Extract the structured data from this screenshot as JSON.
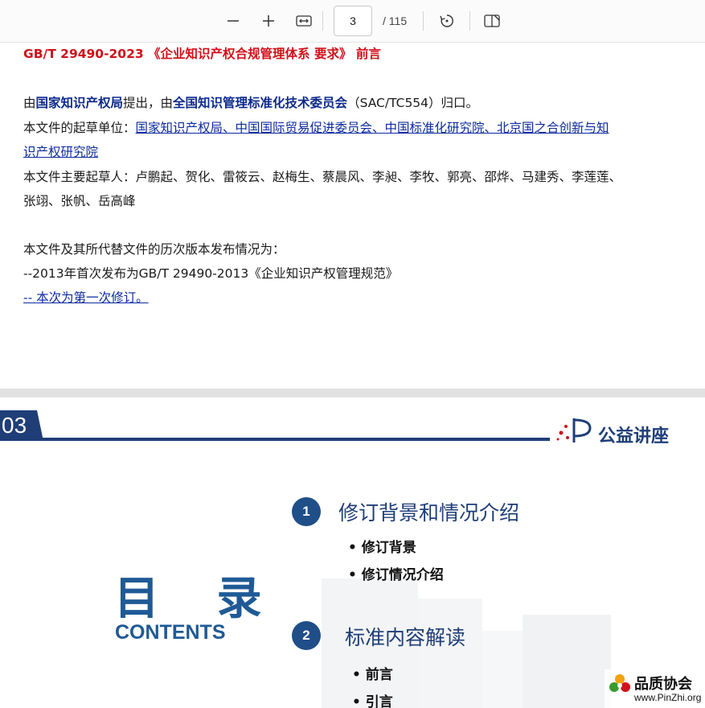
{
  "toolbar": {
    "zoom_out_icon": "minus-icon",
    "zoom_in_icon": "plus-icon",
    "fit_width_icon": "fit-width-icon",
    "page_current": "3",
    "page_total": "/ 115",
    "rotate_icon": "rotate-icon",
    "two_page_icon": "two-page-view-icon"
  },
  "page1": {
    "title": "GB/T 29490-2023 《企业知识产权合规管理体系 要求》 前言",
    "line1": {
      "prefix": "由",
      "org1": "国家知识产权局",
      "mid": "提出，由",
      "org2": "全国知识管理标准化技术委员会",
      "suffix": "（SAC/TC554）归口。"
    },
    "line2": {
      "label": "本文件的起草单位：",
      "link_a": "国家知识产权局、中国国际贸易促进委员会、中国标准化研究院、北京国之合创新与知",
      "link_b": "识产权研究院"
    },
    "line3": {
      "a": "本文件主要起草人：卢鹏起、贺化、雷筱云、赵梅生、蔡晨风、李昶、李牧、郭亮、邵烨、马建秀、李莲莲、",
      "b": "张翊、张帆、岳高峰"
    },
    "history_title": "本文件及其所代替文件的历次版本发布情况为：",
    "history_item1": "--2013年首次发布为GB/T 29490-2013《企业知识产权管理规范》",
    "history_item2": "-- 本次为第一次修订。"
  },
  "page2": {
    "slide_number": "03",
    "brand": "公益讲座",
    "big_title": "目 录",
    "contents_label": "CONTENTS",
    "sections": [
      {
        "num": "1",
        "title": "修订背景和情况介绍",
        "items": [
          "• 修订背景",
          "• 修订情况介绍"
        ]
      },
      {
        "num": "2",
        "title": "标准内容解读",
        "items": [
          "• 前言",
          "• 引言"
        ]
      }
    ],
    "watermark_name": "品质协会",
    "watermark_url": "www.PinZhi.org"
  },
  "colors": {
    "navy": "#1f3e78",
    "title_red": "#d0101a",
    "link_blue": "#0d2a9e",
    "circle_blue": "#1f4e89"
  }
}
